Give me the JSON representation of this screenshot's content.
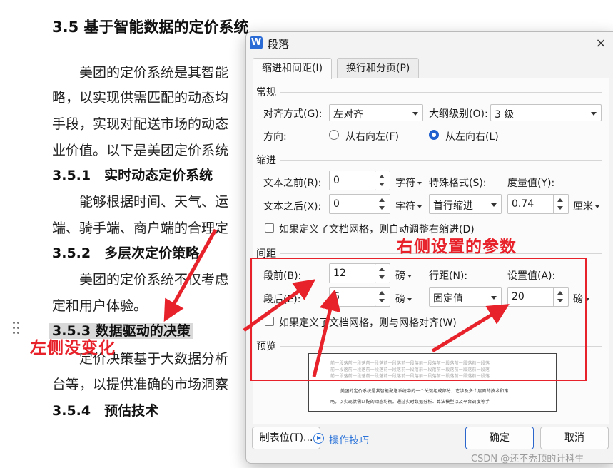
{
  "document": {
    "heading": "3.5 基于智能数据的定价系统",
    "para1_lines": [
      "美团的定价系统是其智能",
      "略，以实现供需匹配的动态均",
      "手段，实现对配送市场的动态",
      "业价值。以下是美团定价系统"
    ],
    "h_351": "3.5.1　实时动态定价系统",
    "para2_lines": [
      "能够根据时间、天气、运",
      "端、骑手端、商户端的合理定"
    ],
    "h_352": "3.5.2　多层次定价策略",
    "para3_lines": [
      "美团的定价系统不仅考虑",
      "定和用户体验。"
    ],
    "h_353": "3.5.3 数据驱动的决策",
    "para4_lines": [
      "定价决策基于大数据分析",
      "台等，以提供准确的市场洞察"
    ],
    "h_354": "3.5.4　预估技术"
  },
  "annotations": {
    "left_note": "左侧没变化",
    "right_note": "右侧设置的参数",
    "color": "#e8222b"
  },
  "dialog": {
    "app_icon": "W",
    "title": "段落",
    "close": "×",
    "tabs": [
      {
        "label": "缩进和间距(I)"
      },
      {
        "label": "换行和分页(P)"
      }
    ],
    "general": {
      "title": "常规",
      "align_label": "对齐方式(G):",
      "align_value": "左对齐",
      "outline_label": "大纲级别(O):",
      "outline_value": "3 级",
      "direction_label": "方向:",
      "rtl_label": "从右向左(F)",
      "ltr_label": "从左向右(L)"
    },
    "indent": {
      "title": "缩进",
      "before_label": "文本之前(R):",
      "before_value": "0",
      "before_unit": "字符",
      "after_label": "文本之后(X):",
      "after_value": "0",
      "after_unit": "字符",
      "special_label": "特殊格式(S):",
      "special_value": "首行缩进",
      "measure_label": "度量值(Y):",
      "measure_value": "0.74",
      "measure_unit": "厘米",
      "grid_check_label": "如果定义了文档网格，则自动调整右缩进(D)"
    },
    "spacing": {
      "title": "间距",
      "before_label": "段前(B):",
      "before_value": "12",
      "before_unit": "磅",
      "after_label": "段后(E):",
      "after_value": "6",
      "after_unit": "磅",
      "line_label": "行距(N):",
      "line_value": "固定值",
      "setting_label": "设置值(A):",
      "setting_value": "20",
      "setting_unit": "磅",
      "grid_check_label": "如果定义了文档网格，则与网格对齐(W)"
    },
    "preview": {
      "title": "预览",
      "ghost_line": "前一段落前一段落前一段落前一段落前一段落前一段落前一段落前一段落前一段落",
      "main_line": "美团的定价系统是其智能配送系统中的一个关键组成部分，它涉及多个层面的技术和策",
      "main_line2": "略，以实现供需匹配的动态均衡。通过实时数据分析、算法模型以及平台调度等手"
    },
    "buttons": {
      "tab_stops": "制表位(T)...",
      "tips": "操作技巧",
      "ok": "确定",
      "cancel": "取消"
    }
  },
  "watermark": "CSDN @还不秃顶的计科生"
}
